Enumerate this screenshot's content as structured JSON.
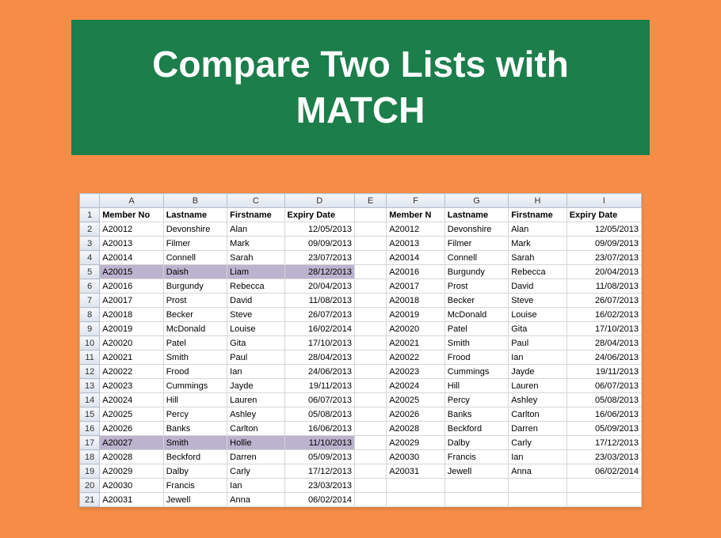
{
  "title": "Compare Two Lists with MATCH",
  "col_letters": [
    "A",
    "B",
    "C",
    "D",
    "E",
    "F",
    "G",
    "H",
    "I"
  ],
  "headers_left": [
    "Member No",
    "Lastname",
    "Firstname",
    "Expiry Date"
  ],
  "headers_right": [
    "Member N",
    "Lastname",
    "Firstname",
    "Expiry Date"
  ],
  "rows": [
    {
      "n": 2,
      "hl": false,
      "l": [
        "A20012",
        "Devonshire",
        "Alan",
        "12/05/2013"
      ],
      "r": [
        "A20012",
        "Devonshire",
        "Alan",
        "12/05/2013"
      ]
    },
    {
      "n": 3,
      "hl": false,
      "l": [
        "A20013",
        "Filmer",
        "Mark",
        "09/09/2013"
      ],
      "r": [
        "A20013",
        "Filmer",
        "Mark",
        "09/09/2013"
      ]
    },
    {
      "n": 4,
      "hl": false,
      "l": [
        "A20014",
        "Connell",
        "Sarah",
        "23/07/2013"
      ],
      "r": [
        "A20014",
        "Connell",
        "Sarah",
        "23/07/2013"
      ]
    },
    {
      "n": 5,
      "hl": true,
      "l": [
        "A20015",
        "Daish",
        "Liam",
        "28/12/2013"
      ],
      "r": [
        "A20016",
        "Burgundy",
        "Rebecca",
        "20/04/2013"
      ]
    },
    {
      "n": 6,
      "hl": false,
      "l": [
        "A20016",
        "Burgundy",
        "Rebecca",
        "20/04/2013"
      ],
      "r": [
        "A20017",
        "Prost",
        "David",
        "11/08/2013"
      ]
    },
    {
      "n": 7,
      "hl": false,
      "l": [
        "A20017",
        "Prost",
        "David",
        "11/08/2013"
      ],
      "r": [
        "A20018",
        "Becker",
        "Steve",
        "26/07/2013"
      ]
    },
    {
      "n": 8,
      "hl": false,
      "l": [
        "A20018",
        "Becker",
        "Steve",
        "26/07/2013"
      ],
      "r": [
        "A20019",
        "McDonald",
        "Louise",
        "16/02/2013"
      ]
    },
    {
      "n": 9,
      "hl": false,
      "l": [
        "A20019",
        "McDonald",
        "Louise",
        "16/02/2014"
      ],
      "r": [
        "A20020",
        "Patel",
        "Gita",
        "17/10/2013"
      ]
    },
    {
      "n": 10,
      "hl": false,
      "l": [
        "A20020",
        "Patel",
        "Gita",
        "17/10/2013"
      ],
      "r": [
        "A20021",
        "Smith",
        "Paul",
        "28/04/2013"
      ]
    },
    {
      "n": 11,
      "hl": false,
      "l": [
        "A20021",
        "Smith",
        "Paul",
        "28/04/2013"
      ],
      "r": [
        "A20022",
        "Frood",
        "Ian",
        "24/06/2013"
      ]
    },
    {
      "n": 12,
      "hl": false,
      "l": [
        "A20022",
        "Frood",
        "Ian",
        "24/06/2013"
      ],
      "r": [
        "A20023",
        "Cummings",
        "Jayde",
        "19/11/2013"
      ]
    },
    {
      "n": 13,
      "hl": false,
      "l": [
        "A20023",
        "Cummings",
        "Jayde",
        "19/11/2013"
      ],
      "r": [
        "A20024",
        "Hill",
        "Lauren",
        "06/07/2013"
      ]
    },
    {
      "n": 14,
      "hl": false,
      "l": [
        "A20024",
        "Hill",
        "Lauren",
        "06/07/2013"
      ],
      "r": [
        "A20025",
        "Percy",
        "Ashley",
        "05/08/2013"
      ]
    },
    {
      "n": 15,
      "hl": false,
      "l": [
        "A20025",
        "Percy",
        "Ashley",
        "05/08/2013"
      ],
      "r": [
        "A20026",
        "Banks",
        "Carlton",
        "16/06/2013"
      ]
    },
    {
      "n": 16,
      "hl": false,
      "l": [
        "A20026",
        "Banks",
        "Carlton",
        "16/06/2013"
      ],
      "r": [
        "A20028",
        "Beckford",
        "Darren",
        "05/09/2013"
      ]
    },
    {
      "n": 17,
      "hl": true,
      "l": [
        "A20027",
        "Smith",
        "Hollie",
        "11/10/2013"
      ],
      "r": [
        "A20029",
        "Dalby",
        "Carly",
        "17/12/2013"
      ]
    },
    {
      "n": 18,
      "hl": false,
      "l": [
        "A20028",
        "Beckford",
        "Darren",
        "05/09/2013"
      ],
      "r": [
        "A20030",
        "Francis",
        "Ian",
        "23/03/2013"
      ]
    },
    {
      "n": 19,
      "hl": false,
      "l": [
        "A20029",
        "Dalby",
        "Carly",
        "17/12/2013"
      ],
      "r": [
        "A20031",
        "Jewell",
        "Anna",
        "06/02/2014"
      ]
    },
    {
      "n": 20,
      "hl": false,
      "l": [
        "A20030",
        "Francis",
        "Ian",
        "23/03/2013"
      ],
      "r": [
        "",
        "",
        "",
        ""
      ]
    },
    {
      "n": 21,
      "hl": false,
      "l": [
        "A20031",
        "Jewell",
        "Anna",
        "06/02/2014"
      ],
      "r": [
        "",
        "",
        "",
        ""
      ]
    }
  ]
}
